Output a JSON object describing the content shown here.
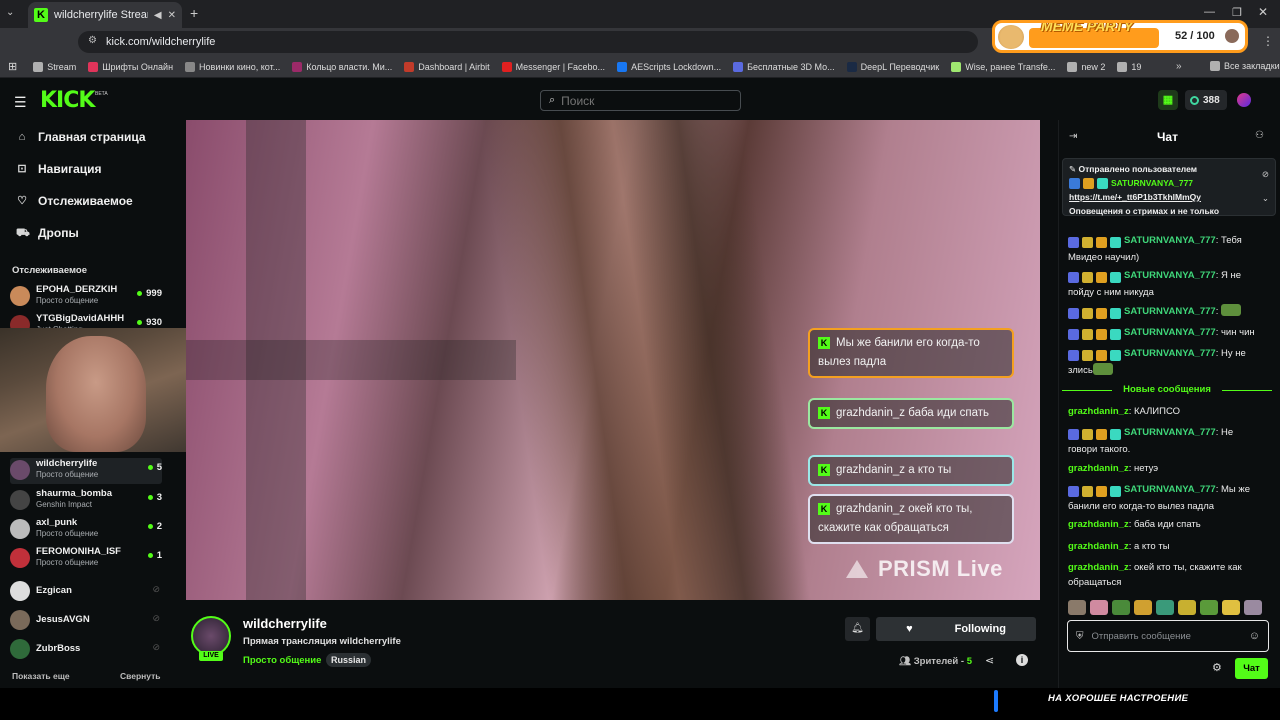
{
  "browser": {
    "tab_title": "wildcherrylife Stream - Watch",
    "url": "kick.com/wildcherrylife",
    "bookmarks": [
      {
        "label": "Stream",
        "color": "#b0b0b0"
      },
      {
        "label": "Шрифты Онлайн",
        "color": "#e0345a"
      },
      {
        "label": "Новинки кино, кот...",
        "color": "#888888"
      },
      {
        "label": "Кольцо власти. Ми...",
        "color": "#9b2a68"
      },
      {
        "label": "Dashboard | Airbit",
        "color": "#c23b2a"
      },
      {
        "label": "Messenger | Facebo...",
        "color": "#e02020"
      },
      {
        "label": "AEScripts Lockdown...",
        "color": "#1877f2"
      },
      {
        "label": "Бесплатные 3D Мо...",
        "color": "#5a6ae0"
      },
      {
        "label": "DeepL Переводчик",
        "color": "#1a2a44"
      },
      {
        "label": "Wise, ранее Transfe...",
        "color": "#9fe870"
      },
      {
        "label": "new 2",
        "color": "#b0b0b0"
      },
      {
        "label": "19",
        "color": "#b0b0b0"
      }
    ],
    "all_bookmarks": "Все закладки"
  },
  "meme_widget": {
    "title": "MEME PARTY",
    "count_text": "52 / 100",
    "progress": 0.52
  },
  "header": {
    "logo": "KICK",
    "search_placeholder": "Поиск",
    "points": "388"
  },
  "sidebar": {
    "nav": [
      {
        "label": "Главная страница",
        "icon": "home-icon"
      },
      {
        "label": "Навигация",
        "icon": "compass-icon"
      },
      {
        "label": "Отслеживаемое",
        "icon": "heart-icon"
      },
      {
        "label": "Дропы",
        "icon": "gift-icon"
      }
    ],
    "following_title": "Отслеживаемое",
    "following": [
      {
        "name": "EPOHA_DERZKIH",
        "sub": "Просто общение",
        "viewers": "999",
        "color": "#c98a5a"
      },
      {
        "name": "YTGBigDavidAHHH",
        "sub": "Just Chatting",
        "viewers": "930",
        "color": "#8a2a2a"
      },
      {
        "name": "wildcherrylife",
        "sub": "Просто общение",
        "viewers": "5",
        "color": "#6a4a6a"
      },
      {
        "name": "shaurma_bomba",
        "sub": "Genshin Impact",
        "viewers": "3",
        "color": "#444444"
      },
      {
        "name": "axl_punk",
        "sub": "Просто общение",
        "viewers": "2",
        "color": "#bbbbbb"
      },
      {
        "name": "FEROMONIHA_ISF",
        "sub": "Просто общение",
        "viewers": "1",
        "color": "#c0303a"
      },
      {
        "name": "Ezgican",
        "sub": "",
        "viewers": "",
        "color": "#dddddd"
      },
      {
        "name": "JesusAVGN",
        "sub": "",
        "viewers": "",
        "color": "#7a6a5a"
      },
      {
        "name": "ZubrBoss",
        "sub": "",
        "viewers": "",
        "color": "#2f6a3a"
      }
    ],
    "show_more": "Показать еще",
    "collapse": "Свернуть"
  },
  "video": {
    "overlay_messages": [
      {
        "text": "Мы же банили его когда-то вылез падла"
      },
      {
        "text": "grazhdanin_z баба иди спать"
      },
      {
        "text": "grazhdanin_z а кто ты"
      },
      {
        "text": "grazhdanin_z окей кто ты, скажите как обращаться"
      }
    ],
    "watermark": "PRISM Live"
  },
  "stream_info": {
    "streamer": "wildcherrylife",
    "live_label": "LIVE",
    "title": "Прямая трансляция wildcherrylife",
    "category": "Просто общение",
    "language": "Russian",
    "follow_label": "Following",
    "viewers_label": "Зрителей -",
    "viewers_count": "5"
  },
  "chat": {
    "title": "Чат",
    "pinned": {
      "header": "Отправлено пользователем",
      "user": "SATURNVANYA_777",
      "link": "https://t.me/+_tt6P1b3TkhlMmQy",
      "text": "Оповещения о стримах и не только"
    },
    "messages": [
      {
        "user": "SATURNVANYA_777",
        "text": "Тебя Мвидео научил)",
        "badges": true
      },
      {
        "user": "SATURNVANYA_777",
        "text": "Я не пойду с ним никуда",
        "badges": true
      },
      {
        "user": "SATURNVANYA_777",
        "text": "",
        "badges": true,
        "emote": true
      },
      {
        "user": "SATURNVANYA_777",
        "text": "чин чин",
        "badges": true
      },
      {
        "user": "SATURNVANYA_777",
        "text": "Ну не злись",
        "badges": true,
        "emote": true
      }
    ],
    "new_messages_label": "Новые сообщения",
    "new_messages": [
      {
        "user": "grazhdanin_z",
        "text": "КАЛИПСО",
        "badges": false
      },
      {
        "user": "SATURNVANYA_777",
        "text": "Не говори такого.",
        "badges": true
      },
      {
        "user": "grazhdanin_z",
        "text": "нетуэ",
        "badges": false
      },
      {
        "user": "SATURNVANYA_777",
        "text": "Мы же банили его когда-то вылез падла",
        "badges": true
      },
      {
        "user": "grazhdanin_z",
        "text": "баба иди спать",
        "badges": false
      },
      {
        "user": "grazhdanin_z",
        "text": "а кто ты",
        "badges": false
      },
      {
        "user": "grazhdanin_z",
        "text": "окей кто ты, скажите как обращаться",
        "badges": false
      }
    ],
    "input_placeholder": "Отправить сообщение",
    "send_label": "Чат"
  },
  "bottom": {
    "mood_text": "НА ХОРОШЕЕ НАСТРОЕНИЕ"
  },
  "colors": {
    "accent": "#53fc18",
    "background": "#0b0e0f"
  }
}
